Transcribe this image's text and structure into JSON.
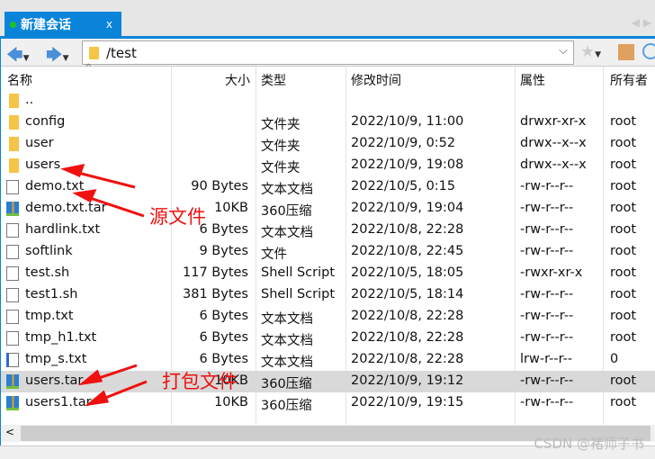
{
  "tab": {
    "title": "新建会话",
    "close": "x"
  },
  "address": {
    "path": "/test"
  },
  "columns": [
    "名称",
    "大小",
    "类型",
    "修改时间",
    "属性",
    "所有者"
  ],
  "files": [
    {
      "name": "..",
      "size": "",
      "type": "",
      "modified": "",
      "attrs": "",
      "owner": "",
      "icon": "folder"
    },
    {
      "name": "config",
      "size": "",
      "type": "文件夹",
      "modified": "2022/10/9, 11:00",
      "attrs": "drwxr-xr-x",
      "owner": "root",
      "icon": "folder"
    },
    {
      "name": "user",
      "size": "",
      "type": "文件夹",
      "modified": "2022/10/9, 0:52",
      "attrs": "drwx--x--x",
      "owner": "root",
      "icon": "folder"
    },
    {
      "name": "users",
      "size": "",
      "type": "文件夹",
      "modified": "2022/10/9, 19:08",
      "attrs": "drwx--x--x",
      "owner": "root",
      "icon": "folder"
    },
    {
      "name": "demo.txt",
      "size": "90 Bytes",
      "type": "文本文档",
      "modified": "2022/10/5, 0:15",
      "attrs": "-rw-r--r--",
      "owner": "root",
      "icon": "text"
    },
    {
      "name": "demo.txt.tar",
      "size": "10KB",
      "type": "360压缩",
      "modified": "2022/10/9, 19:04",
      "attrs": "-rw-r--r--",
      "owner": "root",
      "icon": "archive"
    },
    {
      "name": "hardlink.txt",
      "size": "6 Bytes",
      "type": "文本文档",
      "modified": "2022/10/8, 22:28",
      "attrs": "-rw-r--r--",
      "owner": "root",
      "icon": "text"
    },
    {
      "name": "softlink",
      "size": "9 Bytes",
      "type": "文件",
      "modified": "2022/10/8, 22:45",
      "attrs": "-rw-r--r--",
      "owner": "root",
      "icon": "file"
    },
    {
      "name": "test.sh",
      "size": "117 Bytes",
      "type": "Shell Script",
      "modified": "2022/10/5, 18:05",
      "attrs": "-rwxr-xr-x",
      "owner": "root",
      "icon": "script"
    },
    {
      "name": "test1.sh",
      "size": "381 Bytes",
      "type": "Shell Script",
      "modified": "2022/10/5, 18:14",
      "attrs": "-rw-r--r--",
      "owner": "root",
      "icon": "script"
    },
    {
      "name": "tmp.txt",
      "size": "6 Bytes",
      "type": "文本文档",
      "modified": "2022/10/8, 22:28",
      "attrs": "-rw-r--r--",
      "owner": "root",
      "icon": "text"
    },
    {
      "name": "tmp_h1.txt",
      "size": "6 Bytes",
      "type": "文本文档",
      "modified": "2022/10/8, 22:28",
      "attrs": "-rw-r--r--",
      "owner": "root",
      "icon": "text"
    },
    {
      "name": "tmp_s.txt",
      "size": "6 Bytes",
      "type": "文本文档",
      "modified": "2022/10/8, 22:28",
      "attrs": "lrw-r--r--",
      "owner": "0",
      "icon": "link"
    },
    {
      "name": "users.tar",
      "size": "10KB",
      "type": "360压缩",
      "modified": "2022/10/9, 19:12",
      "attrs": "-rw-r--r--",
      "owner": "root",
      "icon": "archive",
      "selected": true
    },
    {
      "name": "users1.tar",
      "size": "10KB",
      "type": "360压缩",
      "modified": "2022/10/9, 19:15",
      "attrs": "-rw-r--r--",
      "owner": "root",
      "icon": "archive"
    }
  ],
  "annotations": {
    "source": "源文件",
    "packed": "打包文件",
    "color": "#f01010"
  },
  "watermark": "CSDN @褚师子书"
}
